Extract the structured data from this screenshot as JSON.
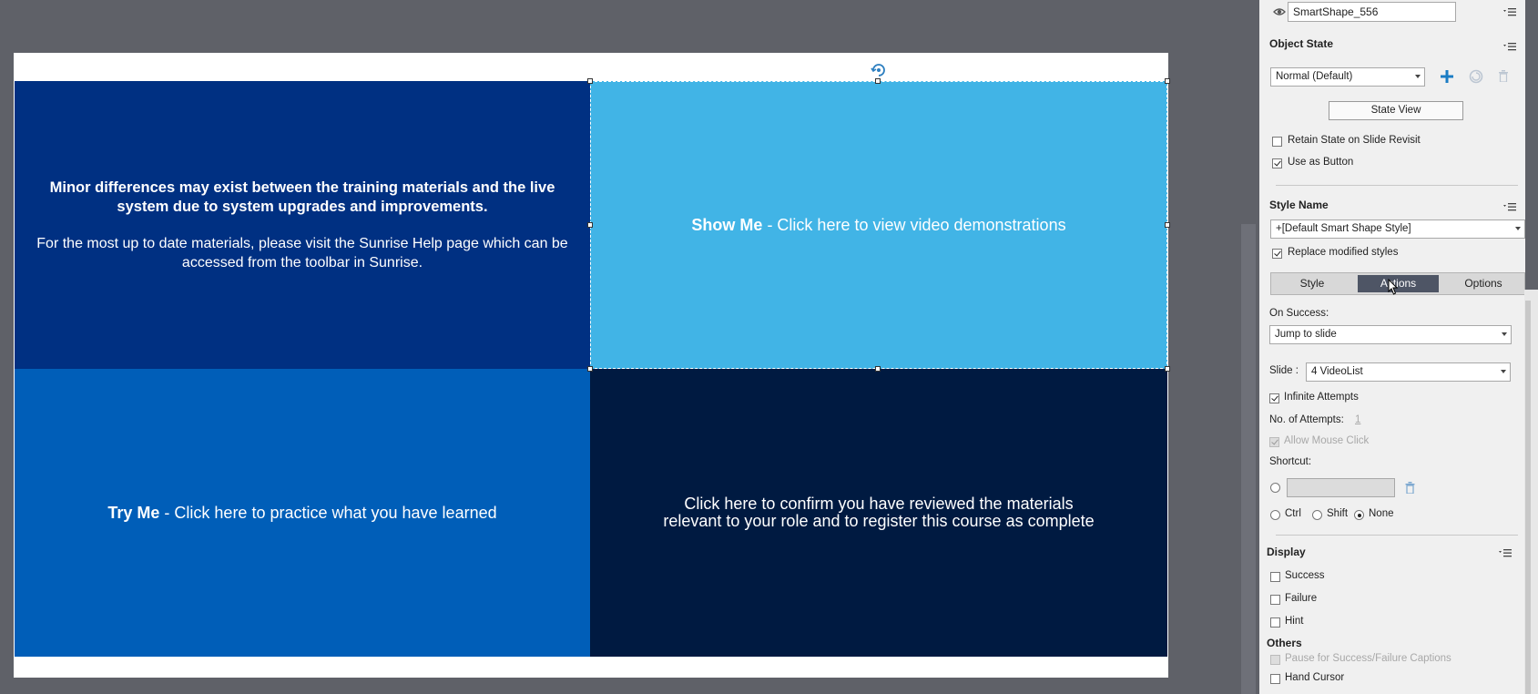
{
  "slide": {
    "top_left": {
      "bold_text": "Minor differences may exist between the training materials and the live system due to system upgrades and improvements.",
      "normal_text": "For the most up to date materials, please visit the Sunrise Help page which can be accessed from the toolbar in Sunrise."
    },
    "top_right": {
      "bold": "Show Me",
      "rest": " - Click here to view video demonstrations"
    },
    "bottom_left": {
      "bold": "Try Me",
      "rest": " - Click here to practice what you have learned"
    },
    "bottom_right": {
      "line1": "Click here to confirm you have reviewed the materials",
      "line2": "relevant to your role and to register this course as complete"
    },
    "colors": {
      "top_left": "#003082",
      "top_right": "#41b4e6",
      "bottom_left": "#005eb8",
      "bottom_right": "#001a41"
    }
  },
  "panel": {
    "object_name": "SmartShape_556",
    "object_state": {
      "header": "Object State",
      "state_value": "Normal (Default)",
      "state_view_label": "State View",
      "retain_state_label": "Retain State on Slide Revisit",
      "use_as_button_label": "Use as Button"
    },
    "style_name": {
      "header": "Style Name",
      "value": "+[Default Smart Shape Style]",
      "replace_label": "Replace modified styles"
    },
    "tabs": [
      {
        "label": "Style"
      },
      {
        "label": "Actions"
      },
      {
        "label": "Options"
      }
    ],
    "actions": {
      "on_success_label": "On Success:",
      "on_success_value": "Jump to slide",
      "slide_label": "Slide :",
      "slide_value": "4 VideoList",
      "infinite_attempts_label": "Infinite Attempts",
      "attempts_label": "No. of Attempts:",
      "attempts_value": "1",
      "allow_mouse_label": "Allow Mouse Click",
      "shortcut_label": "Shortcut:",
      "ctrl_label": "Ctrl",
      "shift_label": "Shift",
      "none_label": "None"
    },
    "display": {
      "header": "Display",
      "success_label": "Success",
      "failure_label": "Failure",
      "hint_label": "Hint"
    },
    "others": {
      "header": "Others",
      "pause_label": "Pause for Success/Failure Captions",
      "hand_cursor_label": "Hand Cursor"
    }
  }
}
